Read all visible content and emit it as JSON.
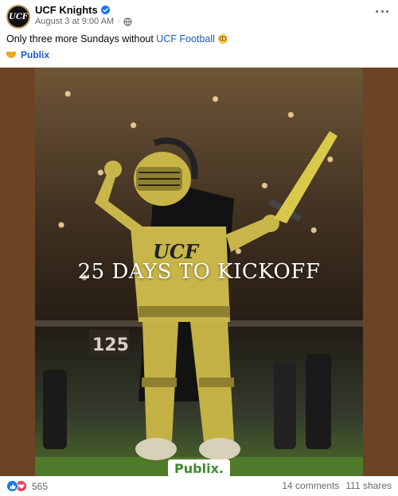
{
  "header": {
    "avatar_text": "UCF",
    "page_name": "UCF Knights",
    "date": "August 3 at 9:00 AM"
  },
  "post": {
    "text_before": "Only three more Sundays without ",
    "text_link": "UCF Football",
    "tag_name": "Publix"
  },
  "image": {
    "title": "25 DAYS TO KICKOFF",
    "chest_logo": "UCF",
    "stadium_sign": "125",
    "sponsor_logo": "Publix."
  },
  "footer": {
    "reaction_count": "565",
    "comments": "14 comments",
    "shares": "111 shares"
  },
  "colors": {
    "link": "#1a5bc4",
    "media_background": "#6a4425",
    "like_blue": "#1877f2",
    "love_red": "#f33e58"
  }
}
